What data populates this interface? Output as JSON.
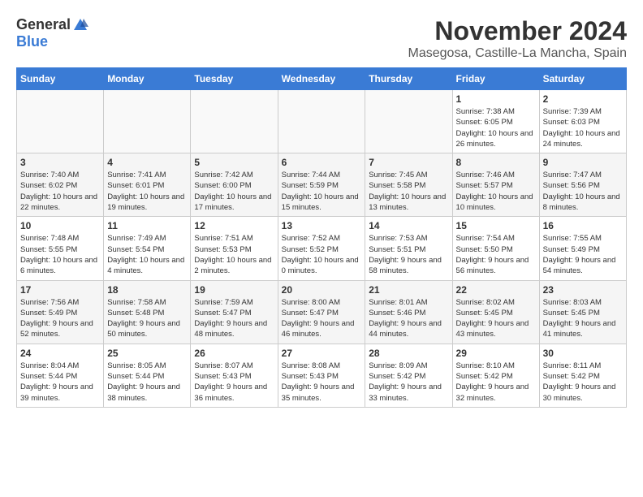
{
  "logo": {
    "general": "General",
    "blue": "Blue"
  },
  "title": {
    "month": "November 2024",
    "location": "Masegosa, Castille-La Mancha, Spain"
  },
  "headers": [
    "Sunday",
    "Monday",
    "Tuesday",
    "Wednesday",
    "Thursday",
    "Friday",
    "Saturday"
  ],
  "weeks": [
    [
      {
        "day": "",
        "info": ""
      },
      {
        "day": "",
        "info": ""
      },
      {
        "day": "",
        "info": ""
      },
      {
        "day": "",
        "info": ""
      },
      {
        "day": "",
        "info": ""
      },
      {
        "day": "1",
        "info": "Sunrise: 7:38 AM\nSunset: 6:05 PM\nDaylight: 10 hours and 26 minutes."
      },
      {
        "day": "2",
        "info": "Sunrise: 7:39 AM\nSunset: 6:03 PM\nDaylight: 10 hours and 24 minutes."
      }
    ],
    [
      {
        "day": "3",
        "info": "Sunrise: 7:40 AM\nSunset: 6:02 PM\nDaylight: 10 hours and 22 minutes."
      },
      {
        "day": "4",
        "info": "Sunrise: 7:41 AM\nSunset: 6:01 PM\nDaylight: 10 hours and 19 minutes."
      },
      {
        "day": "5",
        "info": "Sunrise: 7:42 AM\nSunset: 6:00 PM\nDaylight: 10 hours and 17 minutes."
      },
      {
        "day": "6",
        "info": "Sunrise: 7:44 AM\nSunset: 5:59 PM\nDaylight: 10 hours and 15 minutes."
      },
      {
        "day": "7",
        "info": "Sunrise: 7:45 AM\nSunset: 5:58 PM\nDaylight: 10 hours and 13 minutes."
      },
      {
        "day": "8",
        "info": "Sunrise: 7:46 AM\nSunset: 5:57 PM\nDaylight: 10 hours and 10 minutes."
      },
      {
        "day": "9",
        "info": "Sunrise: 7:47 AM\nSunset: 5:56 PM\nDaylight: 10 hours and 8 minutes."
      }
    ],
    [
      {
        "day": "10",
        "info": "Sunrise: 7:48 AM\nSunset: 5:55 PM\nDaylight: 10 hours and 6 minutes."
      },
      {
        "day": "11",
        "info": "Sunrise: 7:49 AM\nSunset: 5:54 PM\nDaylight: 10 hours and 4 minutes."
      },
      {
        "day": "12",
        "info": "Sunrise: 7:51 AM\nSunset: 5:53 PM\nDaylight: 10 hours and 2 minutes."
      },
      {
        "day": "13",
        "info": "Sunrise: 7:52 AM\nSunset: 5:52 PM\nDaylight: 10 hours and 0 minutes."
      },
      {
        "day": "14",
        "info": "Sunrise: 7:53 AM\nSunset: 5:51 PM\nDaylight: 9 hours and 58 minutes."
      },
      {
        "day": "15",
        "info": "Sunrise: 7:54 AM\nSunset: 5:50 PM\nDaylight: 9 hours and 56 minutes."
      },
      {
        "day": "16",
        "info": "Sunrise: 7:55 AM\nSunset: 5:49 PM\nDaylight: 9 hours and 54 minutes."
      }
    ],
    [
      {
        "day": "17",
        "info": "Sunrise: 7:56 AM\nSunset: 5:49 PM\nDaylight: 9 hours and 52 minutes."
      },
      {
        "day": "18",
        "info": "Sunrise: 7:58 AM\nSunset: 5:48 PM\nDaylight: 9 hours and 50 minutes."
      },
      {
        "day": "19",
        "info": "Sunrise: 7:59 AM\nSunset: 5:47 PM\nDaylight: 9 hours and 48 minutes."
      },
      {
        "day": "20",
        "info": "Sunrise: 8:00 AM\nSunset: 5:47 PM\nDaylight: 9 hours and 46 minutes."
      },
      {
        "day": "21",
        "info": "Sunrise: 8:01 AM\nSunset: 5:46 PM\nDaylight: 9 hours and 44 minutes."
      },
      {
        "day": "22",
        "info": "Sunrise: 8:02 AM\nSunset: 5:45 PM\nDaylight: 9 hours and 43 minutes."
      },
      {
        "day": "23",
        "info": "Sunrise: 8:03 AM\nSunset: 5:45 PM\nDaylight: 9 hours and 41 minutes."
      }
    ],
    [
      {
        "day": "24",
        "info": "Sunrise: 8:04 AM\nSunset: 5:44 PM\nDaylight: 9 hours and 39 minutes."
      },
      {
        "day": "25",
        "info": "Sunrise: 8:05 AM\nSunset: 5:44 PM\nDaylight: 9 hours and 38 minutes."
      },
      {
        "day": "26",
        "info": "Sunrise: 8:07 AM\nSunset: 5:43 PM\nDaylight: 9 hours and 36 minutes."
      },
      {
        "day": "27",
        "info": "Sunrise: 8:08 AM\nSunset: 5:43 PM\nDaylight: 9 hours and 35 minutes."
      },
      {
        "day": "28",
        "info": "Sunrise: 8:09 AM\nSunset: 5:42 PM\nDaylight: 9 hours and 33 minutes."
      },
      {
        "day": "29",
        "info": "Sunrise: 8:10 AM\nSunset: 5:42 PM\nDaylight: 9 hours and 32 minutes."
      },
      {
        "day": "30",
        "info": "Sunrise: 8:11 AM\nSunset: 5:42 PM\nDaylight: 9 hours and 30 minutes."
      }
    ]
  ]
}
